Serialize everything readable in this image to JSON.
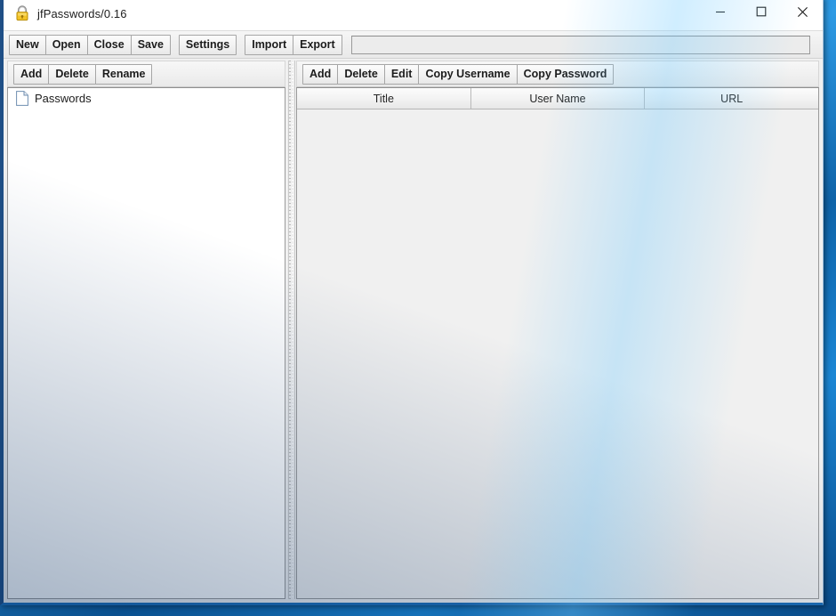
{
  "window": {
    "title": "jfPasswords/0.16",
    "icon": "padlock-icon",
    "controls": {
      "minimize": "minimize-icon",
      "maximize": "maximize-icon",
      "close": "close-icon"
    }
  },
  "main_toolbar": {
    "buttons": [
      {
        "label": "New",
        "name": "new-button"
      },
      {
        "label": "Open",
        "name": "open-button"
      },
      {
        "label": "Close",
        "name": "close-button"
      },
      {
        "label": "Save",
        "name": "save-button"
      },
      {
        "label": "Settings",
        "name": "settings-button"
      },
      {
        "label": "Import",
        "name": "import-button"
      },
      {
        "label": "Export",
        "name": "export-button"
      }
    ],
    "search": {
      "value": "",
      "placeholder": ""
    }
  },
  "left_pane": {
    "toolbar": [
      {
        "label": "Add",
        "name": "tree-add-button"
      },
      {
        "label": "Delete",
        "name": "tree-delete-button"
      },
      {
        "label": "Rename",
        "name": "tree-rename-button"
      }
    ],
    "tree": {
      "items": [
        {
          "label": "Passwords",
          "icon": "document-icon"
        }
      ]
    }
  },
  "right_pane": {
    "toolbar": [
      {
        "label": "Add",
        "name": "entry-add-button"
      },
      {
        "label": "Delete",
        "name": "entry-delete-button"
      },
      {
        "label": "Edit",
        "name": "entry-edit-button"
      },
      {
        "label": "Copy Username",
        "name": "copy-username-button"
      },
      {
        "label": "Copy Password",
        "name": "copy-password-button"
      }
    ],
    "table": {
      "columns": [
        "Title",
        "User Name",
        "URL"
      ],
      "rows": []
    }
  },
  "colors": {
    "desktop": "#1d77c4",
    "window_border": "#1f4f86",
    "toolbar_bg": "#efefef",
    "panel_bg": "#f0f0f0",
    "tree_bg": "#ffffff",
    "lock_body": "#f2c327",
    "lock_shackle": "#8e8e8e"
  }
}
